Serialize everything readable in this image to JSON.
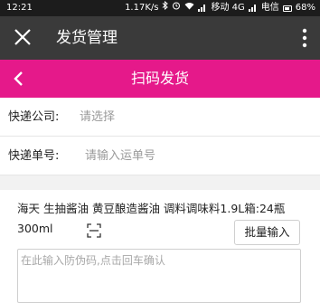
{
  "status_bar": {
    "time": "12:21",
    "net_speed": "1.17K/s",
    "carrier1": "移动 4G",
    "carrier2": "电信",
    "battery": "68%"
  },
  "title_bar": {
    "title": "发货管理",
    "close_icon": "close-icon",
    "more_icon": "more-vertical-icon"
  },
  "nav_bar": {
    "title": "扫码发货",
    "back_icon": "chevron-left-icon",
    "background_color": "#e5198a"
  },
  "form": {
    "courier_label": "快递公司:",
    "courier_value": "请选择",
    "tracking_label": "快递单号:",
    "tracking_placeholder": "请输入运单号"
  },
  "product": {
    "name": "海天 生抽酱油 黄豆酿造酱油 调料调味料1.9L箱:24瓶 300ml",
    "scan_icon": "scan-icon",
    "batch_button": "批量输入",
    "code_placeholder": "在此输入防伪码,点击回车确认"
  }
}
